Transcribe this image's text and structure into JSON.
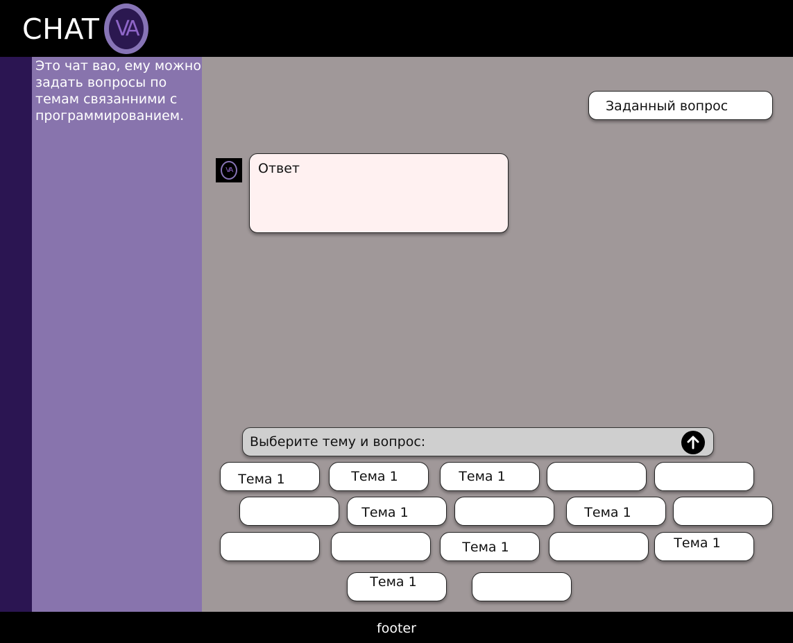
{
  "header": {
    "title": "CHAT",
    "logo_text": "VA"
  },
  "sidebar": {
    "description": "Это чат вао, ему можно задать вопросы по темам связанними с программированием."
  },
  "chat": {
    "question": "Заданный вопрос",
    "answer": "Ответ",
    "avatar_text": "VA"
  },
  "composer": {
    "placeholder": "Выберите тему и вопрос:",
    "send_icon": "arrow-up-icon"
  },
  "topics": [
    "Тема 1",
    "Тема 1",
    "Тема 1",
    "",
    "",
    "",
    "Тема 1",
    "",
    "Тема 1",
    "",
    "",
    "",
    "Тема 1",
    "",
    "Тема 1",
    "Тема 1",
    ""
  ],
  "footer": {
    "text": "footer"
  },
  "colors": {
    "header_bg": "#000000",
    "rail": "#2b1552",
    "sidebar": "#8874ad",
    "main_bg": "#a09899",
    "answer_bg": "#fff1f1",
    "composer_bg": "#cfcfcf",
    "logo_ring": "#8774b6"
  }
}
